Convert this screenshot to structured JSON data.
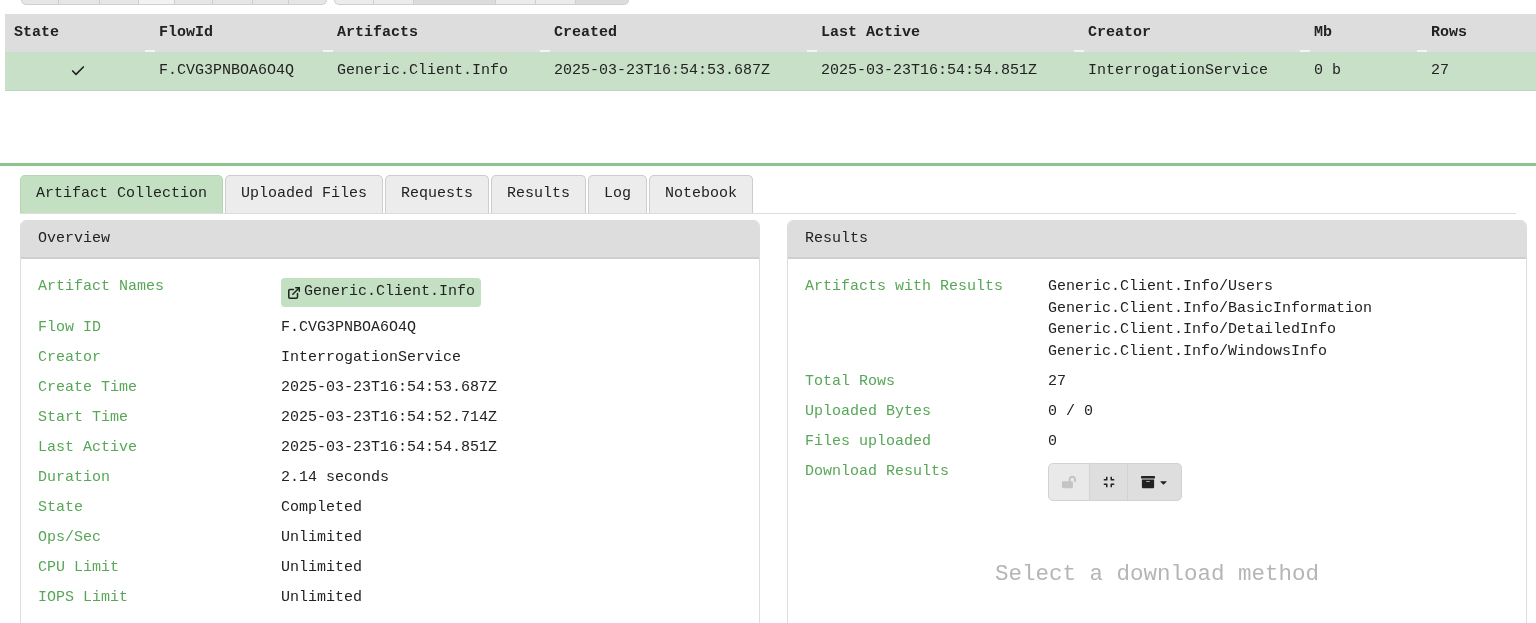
{
  "flows_table": {
    "columns": [
      "State",
      "FlowId",
      "Artifacts",
      "Created",
      "Last Active",
      "Creator",
      "Mb",
      "Rows"
    ],
    "rows": [
      {
        "selected": true,
        "completed": true,
        "cells": [
          "",
          "F.CVG3PNBOA6O4Q",
          "Generic.Client.Info",
          "2025-03-23T16:54:53.687Z",
          "2025-03-23T16:54:54.851Z",
          "InterrogationService",
          "0 b",
          "27"
        ]
      }
    ]
  },
  "tabs": [
    {
      "label": "Artifact Collection",
      "selected": true
    },
    {
      "label": "Uploaded Files",
      "selected": false
    },
    {
      "label": "Requests",
      "selected": false
    },
    {
      "label": "Results",
      "selected": false
    },
    {
      "label": "Log",
      "selected": false
    },
    {
      "label": "Notebook",
      "selected": false
    }
  ],
  "overview": {
    "title": "Overview",
    "fields": [
      {
        "kind": "artifact_links",
        "label": "Artifact Names",
        "artifacts": [
          "Generic.Client.Info"
        ]
      },
      {
        "kind": "text",
        "label": "Flow ID",
        "value": "F.CVG3PNBOA6O4Q"
      },
      {
        "kind": "text",
        "label": "Creator",
        "value": "InterrogationService"
      },
      {
        "kind": "text",
        "label": "Create Time",
        "value": "2025-03-23T16:54:53.687Z"
      },
      {
        "kind": "text",
        "label": "Start Time",
        "value": "2025-03-23T16:54:52.714Z"
      },
      {
        "kind": "text",
        "label": "Last Active",
        "value": "2025-03-23T16:54:54.851Z"
      },
      {
        "kind": "text",
        "label": "Duration",
        "value": "2.14 seconds"
      },
      {
        "kind": "text",
        "label": "State",
        "value": "Completed"
      },
      {
        "kind": "text",
        "label": "Ops/Sec",
        "value": "Unlimited"
      },
      {
        "kind": "text",
        "label": "CPU Limit",
        "value": "Unlimited"
      },
      {
        "kind": "text",
        "label": "IOPS Limit",
        "value": "Unlimited"
      }
    ]
  },
  "results": {
    "title": "Results",
    "fields": [
      {
        "kind": "lines",
        "label": "Artifacts with Results",
        "lines": [
          "Generic.Client.Info/Users",
          "Generic.Client.Info/BasicInformation",
          "Generic.Client.Info/DetailedInfo",
          "Generic.Client.Info/WindowsInfo"
        ]
      },
      {
        "kind": "text",
        "label": "Total Rows",
        "value": "27"
      },
      {
        "kind": "text",
        "label": "Uploaded Bytes",
        "value": "0 / 0"
      },
      {
        "kind": "text",
        "label": "Files uploaded",
        "value": "0"
      },
      {
        "kind": "download",
        "label": "Download Results",
        "buttons": [
          {
            "disabled": true
          },
          {
            "disabled": false
          },
          {
            "disabled": false
          }
        ]
      }
    ],
    "download_hint": "Select a download method"
  }
}
